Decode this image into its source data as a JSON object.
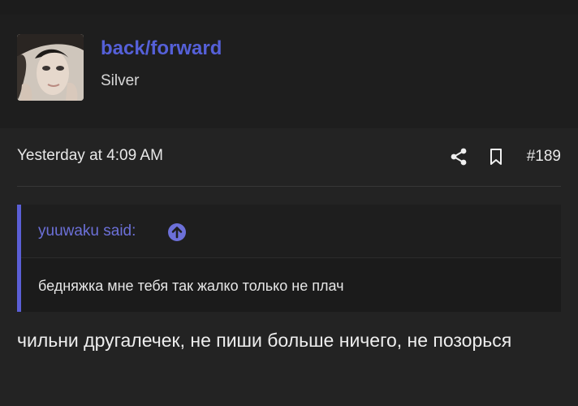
{
  "post": {
    "username": "back/forward",
    "user_title": "Silver",
    "timestamp": "Yesterday at 4:09 AM",
    "post_number": "#189",
    "quote": {
      "author": "yuuwaku said:",
      "text": "бедняжка мне тебя так жалко только не плач"
    },
    "message": "чильни другалечек, не пиши больше ничего, не позорься"
  },
  "colors": {
    "accent": "#5560d8",
    "background": "#232323",
    "header_background": "#1e1e1e"
  },
  "icons": {
    "share": "share-icon",
    "bookmark": "bookmark-icon",
    "jump": "arrow-up-circle-icon"
  }
}
